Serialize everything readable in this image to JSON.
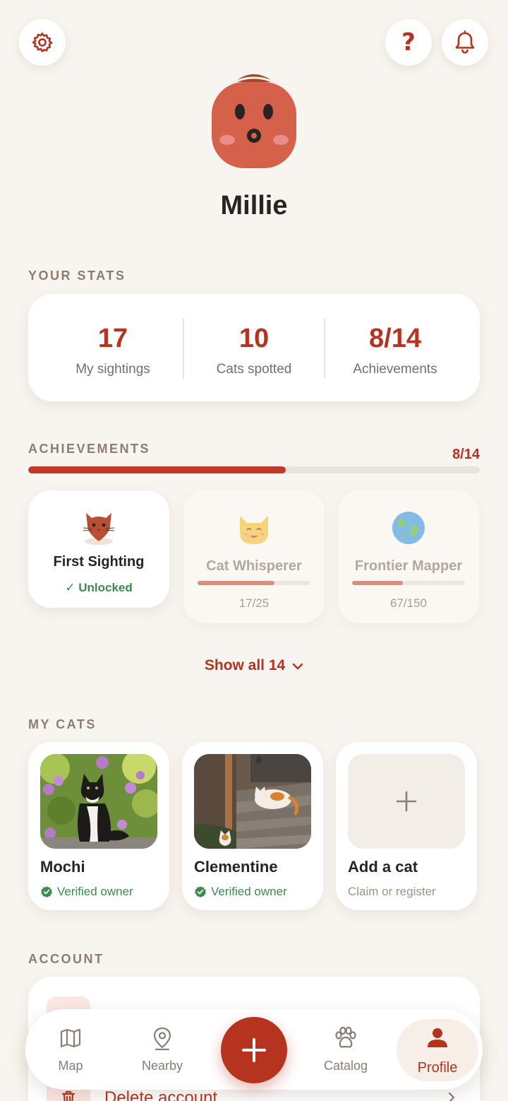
{
  "header": {
    "help_label": "?",
    "icons": {
      "settings": "gear-icon",
      "help": "question-icon",
      "notifications": "bell-icon"
    }
  },
  "profile": {
    "name": "Millie"
  },
  "stats": {
    "section_label": "YOUR STATS",
    "items": [
      {
        "value": "17",
        "label": "My sightings"
      },
      {
        "value": "10",
        "label": "Cats spotted"
      },
      {
        "value": "8/14",
        "label": "Achievements"
      }
    ]
  },
  "achievements": {
    "section_label": "ACHIEVEMENTS",
    "count_text": "8/14",
    "progress_fraction": 0.57,
    "items": [
      {
        "title": "First Sighting",
        "status": "✓ Unlocked",
        "icon": "cat-head-icon",
        "unlocked": true
      },
      {
        "title": "Cat Whisperer",
        "progress_text": "17/25",
        "progress_fraction": 0.68,
        "icon": "smiling-cat-icon",
        "unlocked": false
      },
      {
        "title": "Frontier Mapper",
        "progress_text": "67/150",
        "progress_fraction": 0.45,
        "icon": "globe-icon",
        "unlocked": false
      }
    ],
    "show_all_label": "Show all 14"
  },
  "my_cats": {
    "section_label": "MY CATS",
    "items": [
      {
        "name": "Mochi",
        "status": "Verified owner"
      },
      {
        "name": "Clementine",
        "status": "Verified owner"
      }
    ],
    "add": {
      "title": "Add a cat",
      "subtitle": "Claim or register"
    }
  },
  "account": {
    "section_label": "ACCOUNT",
    "delete_label": "Delete account"
  },
  "nav": {
    "items": [
      {
        "label": "Map",
        "icon": "map-icon"
      },
      {
        "label": "Nearby",
        "icon": "location-pin-icon"
      },
      {
        "label": "Catalog",
        "icon": "paw-icon"
      },
      {
        "label": "Profile",
        "icon": "person-icon",
        "active": true
      }
    ],
    "fab_icon": "plus-icon"
  },
  "colors": {
    "accent": "#b5331f",
    "background": "#f8f4ef",
    "success": "#3c8a4d"
  }
}
